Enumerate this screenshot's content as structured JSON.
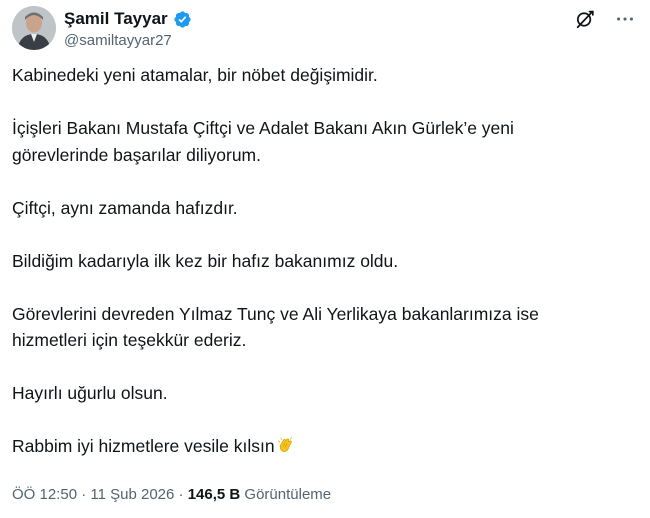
{
  "post": {
    "author": {
      "name": "Şamil Tayyar",
      "handle": "@samiltayyar27"
    },
    "icons": {
      "verified": "verified-badge-icon",
      "grok": "grok-icon",
      "more": "more-icon",
      "reaction": "clapping-hands-emoji"
    },
    "colors": {
      "verified": "#1d9bf0",
      "text": "#0f1419",
      "secondary": "#536471",
      "emoji": "#f5c518"
    },
    "text": {
      "p1": "Kabinedeki yeni atamalar, bir nöbet değişimidir.",
      "p2a": "İçişleri Bakanı Mustafa Çiftçi ve Adalet Bakanı Akın Gürlek’e yeni",
      "p2b": "görevlerinde başarılar diliyorum.",
      "p3": "Çiftçi, aynı zamanda hafızdır.",
      "p4": "Bildiğim kadarıyla ilk kez bir hafız bakanımız oldu.",
      "p5a": "Görevlerini devreden Yılmaz Tunç ve Ali Yerlikaya bakanlarımıza ise",
      "p5b": "hizmetleri için teşekkür ederiz.",
      "p6": "Hayırlı uğurlu olsun.",
      "p7": "Rabbim iyi hizmetlere vesile kılsın"
    },
    "meta": {
      "time": "ÖÖ 12:50",
      "separator1": " · ",
      "date": "11 Şub 2026",
      "separator2": " · ",
      "views": "146,5 B",
      "views_label": " Görüntüleme"
    }
  }
}
